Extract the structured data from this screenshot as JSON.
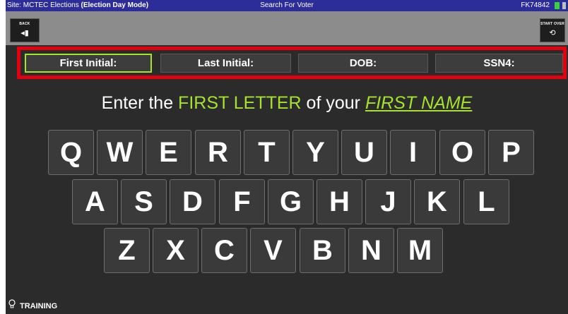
{
  "titlebar": {
    "site_prefix": "Site: MCTEC Elections ",
    "mode": "(Election Day Mode)",
    "title": "Search For Voter",
    "device_id": "FK74842"
  },
  "toolbar": {
    "back_label": "BACK",
    "back_icon": "◂▮",
    "start_over_label": "START OVER",
    "start_over_icon": "⟲"
  },
  "fields": [
    {
      "label": "First Initial:",
      "active": true
    },
    {
      "label": "Last Initial:",
      "active": false
    },
    {
      "label": "DOB:",
      "active": false
    },
    {
      "label": "SSN4:",
      "active": false
    }
  ],
  "prompt": {
    "part1": "Enter the ",
    "highlight": "FIRST LETTER",
    "part2": " of your ",
    "target": "FIRST NAME"
  },
  "keyboard": {
    "row1": [
      "Q",
      "W",
      "E",
      "R",
      "T",
      "Y",
      "U",
      "I",
      "O",
      "P"
    ],
    "row2": [
      "A",
      "S",
      "D",
      "F",
      "G",
      "H",
      "J",
      "K",
      "L"
    ],
    "row3": [
      "Z",
      "X",
      "C",
      "V",
      "B",
      "N",
      "M"
    ]
  },
  "footer": {
    "mode_label": "TRAINING"
  },
  "colors": {
    "accent_green": "#a6e22e",
    "highlight_red": "#e3000f",
    "titlebar_blue": "#2d2d9a"
  }
}
